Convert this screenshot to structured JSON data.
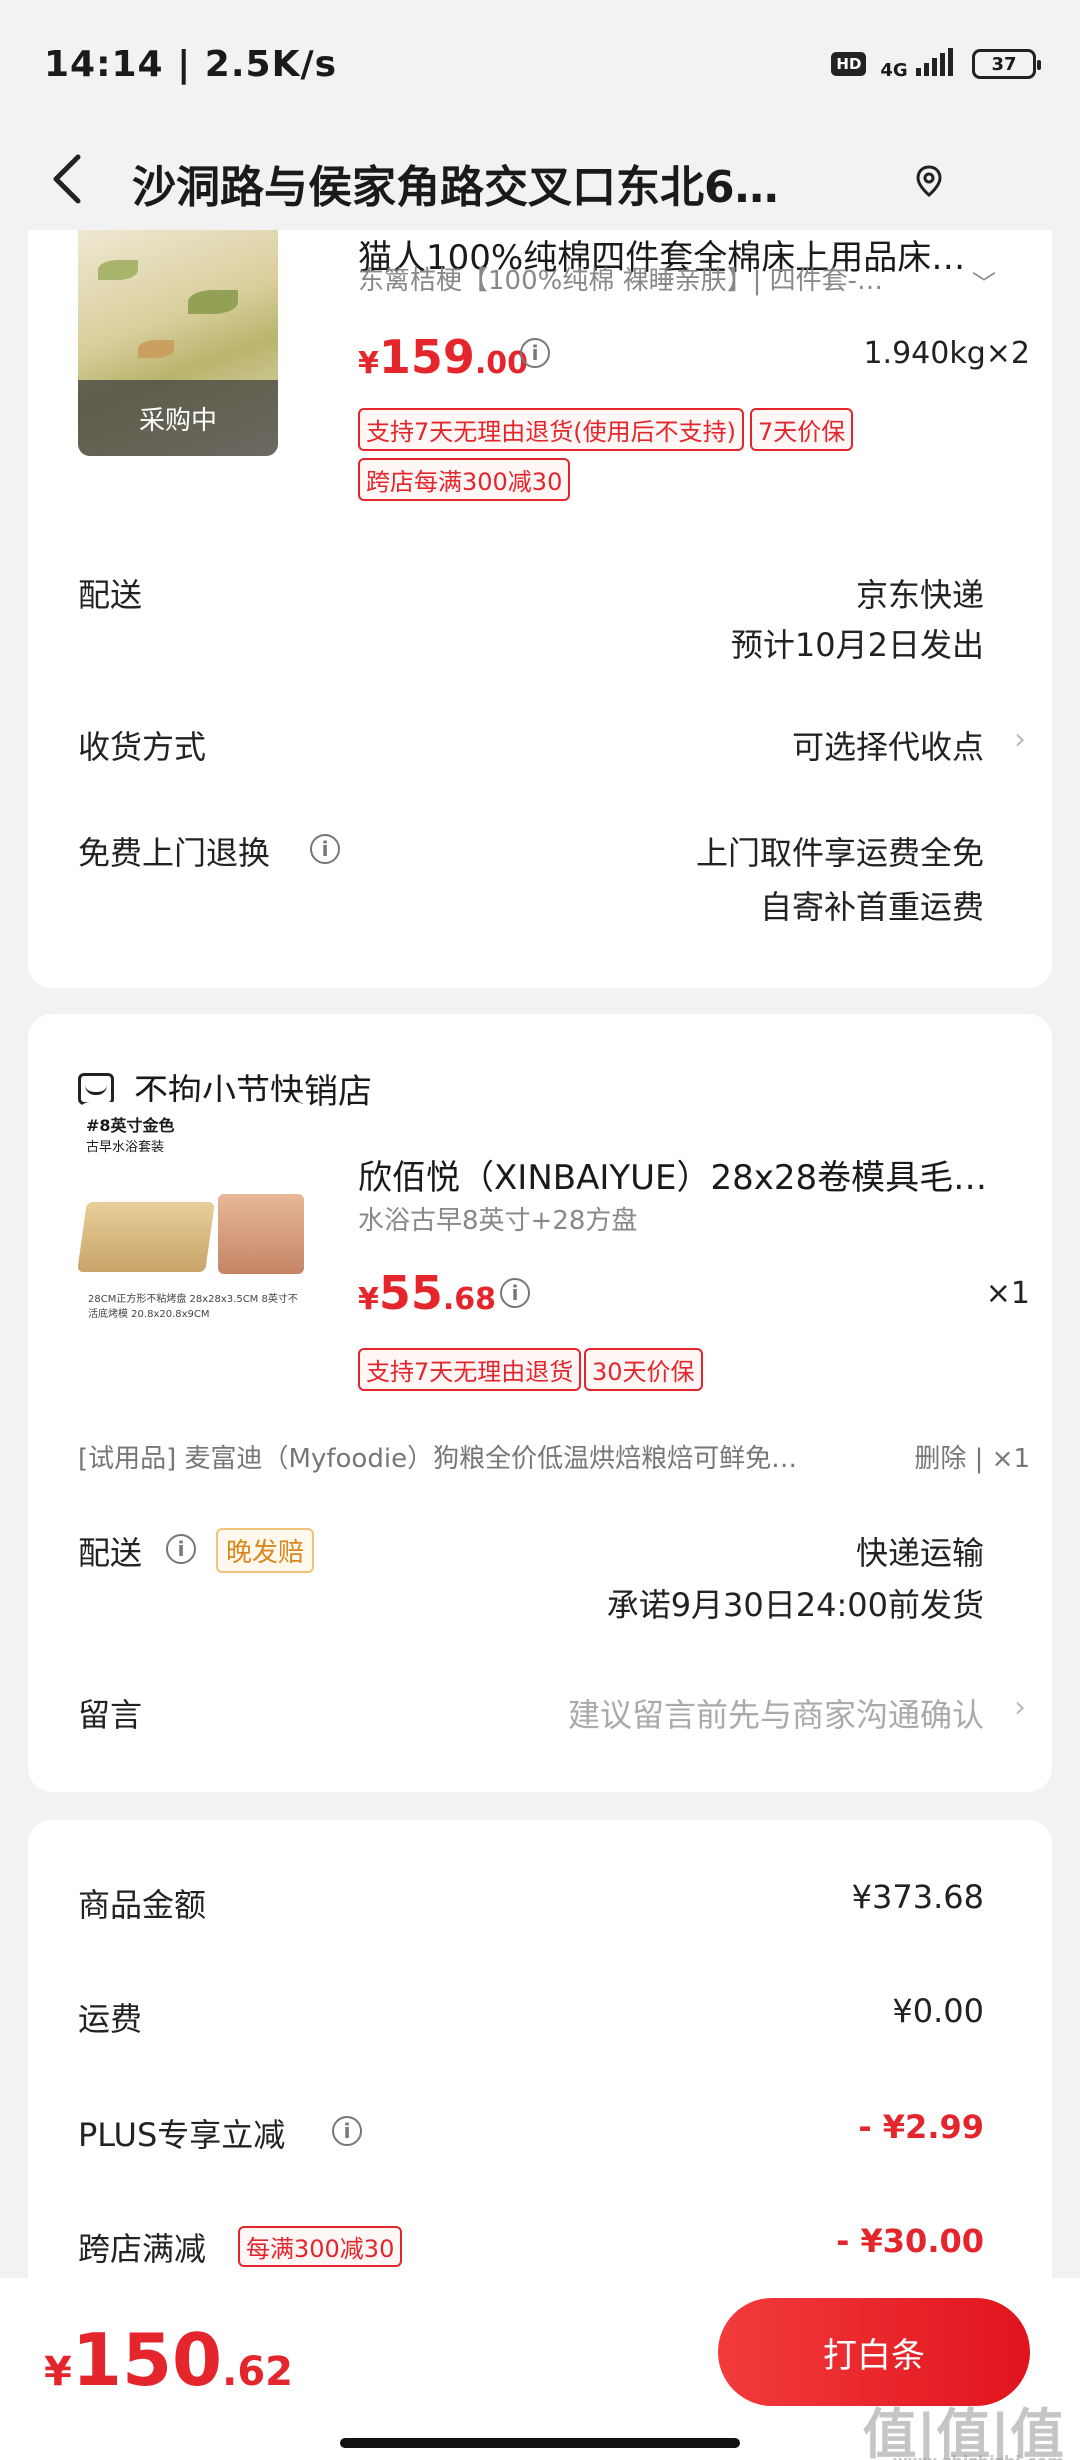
{
  "status": {
    "time": "14:14 | 2.5K/s",
    "hd": "HD",
    "network": "4G",
    "battery": "37"
  },
  "header": {
    "title": "沙洞路与侯家角路交叉口东北6…"
  },
  "product1": {
    "title": "猫人100%纯棉四件套全棉床上用品床…",
    "spec": "东篱桔梗【100%纯棉 裸睡亲肤】| 四件套-…",
    "price_yen": "¥",
    "price_int": "159",
    "price_dec": ".00",
    "weight_qty": "1.940kg×2",
    "badge": "采购中",
    "tags": [
      "支持7天无理由退货(使用后不支持)",
      "7天价保",
      "跨店每满300减30"
    ]
  },
  "card1": {
    "delivery_label": "配送",
    "delivery_value1": "京东快递",
    "delivery_value2": "预计10月2日发出",
    "receive_label": "收货方式",
    "receive_value": "可选择代收点",
    "return_label": "免费上门退换",
    "return_value1": "上门取件享运费全免",
    "return_value2": "自寄补首重运费"
  },
  "shop2": {
    "name": "不拘小节快销店",
    "product": {
      "title": "欣佰悦（XINBAIYUE）28x28卷模具毛…",
      "spec": "水浴古早8英寸+28方盘",
      "price_yen": "¥",
      "price_int": "55",
      "price_dec": ".68",
      "qty": "×1",
      "img_title": "#8英寸金色",
      "img_sub": "古早水浴套装",
      "img_caption": "28CM正方形不粘烤盘 28x28x3.5CM    8英寸不活底烤模 20.8x20.8x9CM",
      "tags": [
        "支持7天无理由退货",
        "30天价保"
      ]
    },
    "gift": "[试用品]  麦富迪（Myfoodie）狗粮全价低温烘焙粮焙可鲜免…",
    "gift_right": "删除 | ×1",
    "delivery_label": "配送",
    "late_tag": "晚发赔",
    "delivery_value1": "快递运输",
    "delivery_value2": "承诺9月30日24:00前发货",
    "msg_label": "留言",
    "msg_placeholder": "建议留言前先与商家沟通确认"
  },
  "summary": {
    "goods_label": "商品金额",
    "goods_value": "¥373.68",
    "freight_label": "运费",
    "freight_value": "¥0.00",
    "plus_label": "PLUS专享立减",
    "plus_value": "- ¥2.99",
    "cross_label": "跨店满减",
    "cross_tag": "每满300减30",
    "cross_value": "- ¥30.00"
  },
  "bottom": {
    "yen": "¥",
    "int": "150",
    "dec": ".62",
    "pay_label": "打白条"
  },
  "watermark": {
    "main": "值|值|值",
    "sub": "www.zhizhizhi.com"
  }
}
